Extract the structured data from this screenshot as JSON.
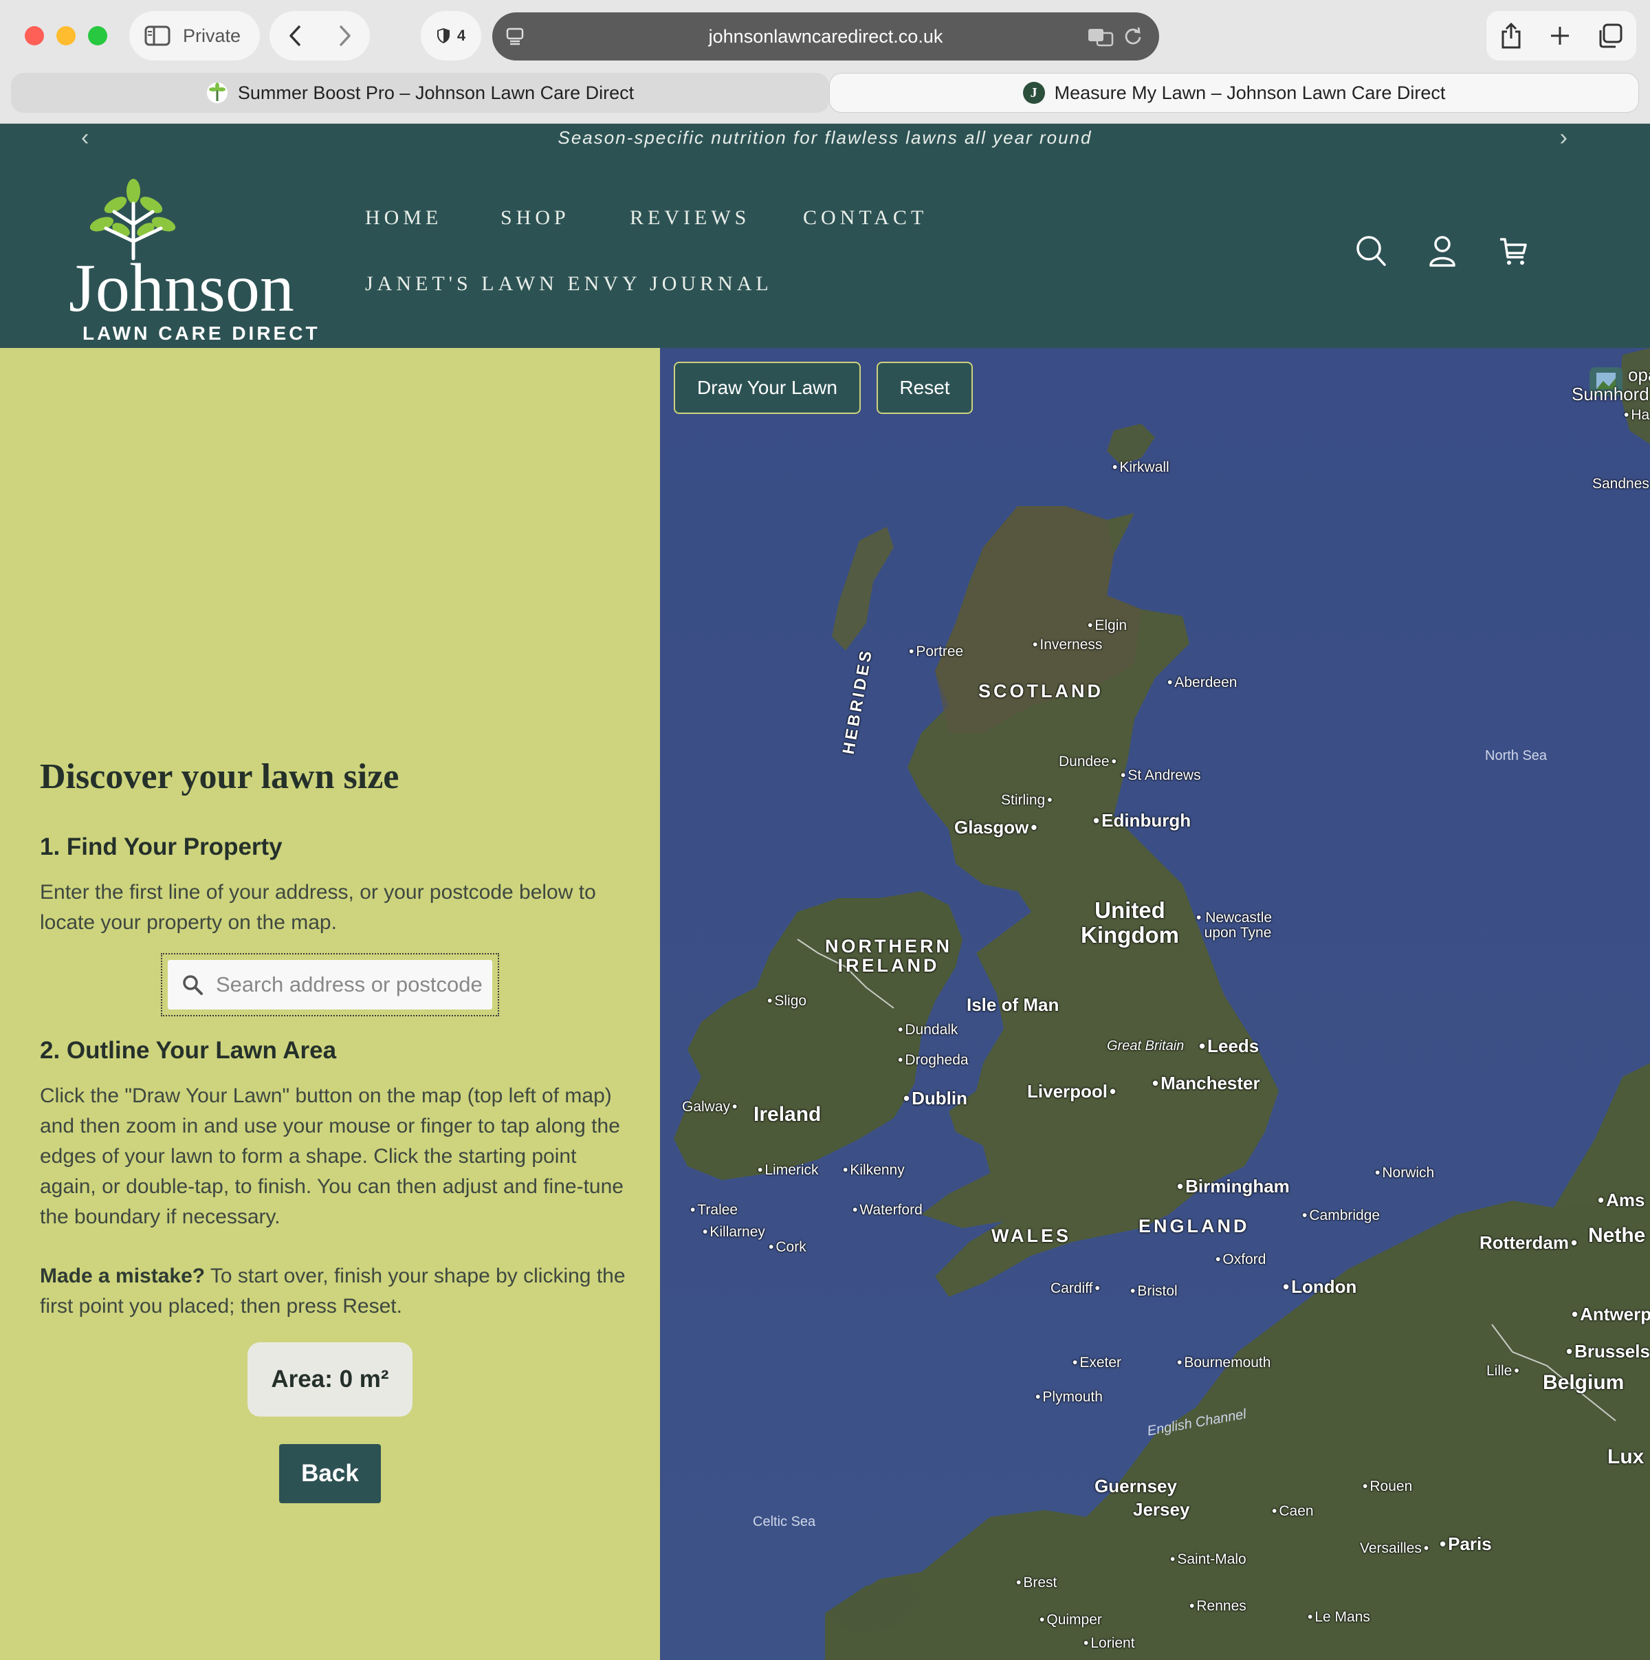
{
  "browser": {
    "private_label": "Private",
    "shield_count": "4",
    "url": "johnsonlawncaredirect.co.uk",
    "tabs": [
      {
        "title": "Summer Boost Pro – Johnson Lawn Care Direct",
        "active": false
      },
      {
        "title": "Measure My Lawn – Johnson Lawn Care Direct",
        "active": true
      }
    ],
    "tab_favicon_letter": "J"
  },
  "announcement": {
    "text": "Season-specific nutrition for flawless lawns all year round"
  },
  "header": {
    "logo_name": "Johnson",
    "logo_tagline": "LAWN CARE DIRECT",
    "nav": {
      "home": "HOME",
      "shop": "SHOP",
      "reviews": "REVIEWS",
      "contact": "CONTACT",
      "journal": "JANET'S LAWN ENVY JOURNAL"
    }
  },
  "panel": {
    "title": "Discover your lawn size",
    "step1_heading": "1. Find Your Property",
    "step1_text": "Enter the first line of your address, or your postcode below to locate your property on the map.",
    "search_placeholder": "Search address or postcode",
    "step2_heading": "2. Outline Your Lawn Area",
    "step2_text": "Click the \"Draw Your Lawn\" button on the map (top left of map) and then zoom in and use your mouse or finger to tap along the edges of your lawn to form a shape. Click the starting point again, or double-tap, to finish. You can then adjust and fine-tune the boundary if necessary.",
    "mistake_bold": "Made a mistake?",
    "mistake_text": " To start over, finish your shape by clicking the first point you placed; then press Reset.",
    "area_label": "Area: 0 m²",
    "back_label": "Back"
  },
  "map": {
    "draw_label": "Draw Your Lawn",
    "reset_label": "Reset",
    "labels": {
      "kirkwall": "Kirkwall",
      "elgin": "Elgin",
      "inverness": "Inverness",
      "portree": "Portree",
      "hebrides": "HEBRIDES",
      "scotland": "SCOTLAND",
      "aberdeen": "Aberdeen",
      "dundee": "Dundee",
      "st_andrews": "St Andrews",
      "stirling": "Stirling",
      "glasgow": "Glasgow",
      "edinburgh": "Edinburgh",
      "north_sea": "North Sea",
      "united_kingdom_1": "United",
      "united_kingdom_2": "Kingdom",
      "newcastle_1": "Newcastle",
      "newcastle_2": "upon Tyne",
      "northern_ireland_1": "NORTHERN",
      "northern_ireland_2": "IRELAND",
      "sligo": "Sligo",
      "isle_of_man": "Isle of Man",
      "dundalk": "Dundalk",
      "drogheda": "Drogheda",
      "great_britain": "Great Britain",
      "leeds": "Leeds",
      "galway": "Galway",
      "ireland": "Ireland",
      "dublin": "Dublin",
      "liverpool": "Liverpool",
      "manchester": "Manchester",
      "limerick": "Limerick",
      "kilkenny": "Kilkenny",
      "tralee": "Tralee",
      "waterford": "Waterford",
      "killarney": "Killarney",
      "cork": "Cork",
      "birmingham": "Birmingham",
      "norwich": "Norwich",
      "cambridge": "Cambridge",
      "wales": "WALES",
      "england": "ENGLAND",
      "oxford": "Oxford",
      "cardiff": "Cardiff",
      "bristol": "Bristol",
      "london": "London",
      "exeter": "Exeter",
      "bournemouth": "Bournemouth",
      "plymouth": "Plymouth",
      "english_channel": "English Channel",
      "guernsey": "Guernsey",
      "jersey": "Jersey",
      "caen": "Caen",
      "rouen": "Rouen",
      "celtic_sea": "Celtic Sea",
      "saint_malo": "Saint-Malo",
      "versailles": "Versailles",
      "paris": "Paris",
      "brest": "Brest",
      "rennes": "Rennes",
      "quimper": "Quimper",
      "le_mans": "Le Mans",
      "lorient": "Lorient",
      "rotterdam": "Rotterdam",
      "netherlands_partial": "Nethe",
      "amsterdam_partial": "Ams",
      "antwerp_partial": "Antwerp",
      "brussels": "Brussels",
      "lille": "Lille",
      "belgium": "Belgium",
      "lux_partial": "Lux",
      "sandnes_partial": "Sandnes",
      "ha_partial": "Ha",
      "top_right_partial_1": "opa",
      "top_right_partial_2": "Sunnhord"
    }
  },
  "colors": {
    "header_teal": "#2d5254",
    "panel_green": "#cdd47d",
    "button_teal": "#2d5254",
    "map_sea": "#3b4f86",
    "map_land": "#4e5a3a"
  }
}
